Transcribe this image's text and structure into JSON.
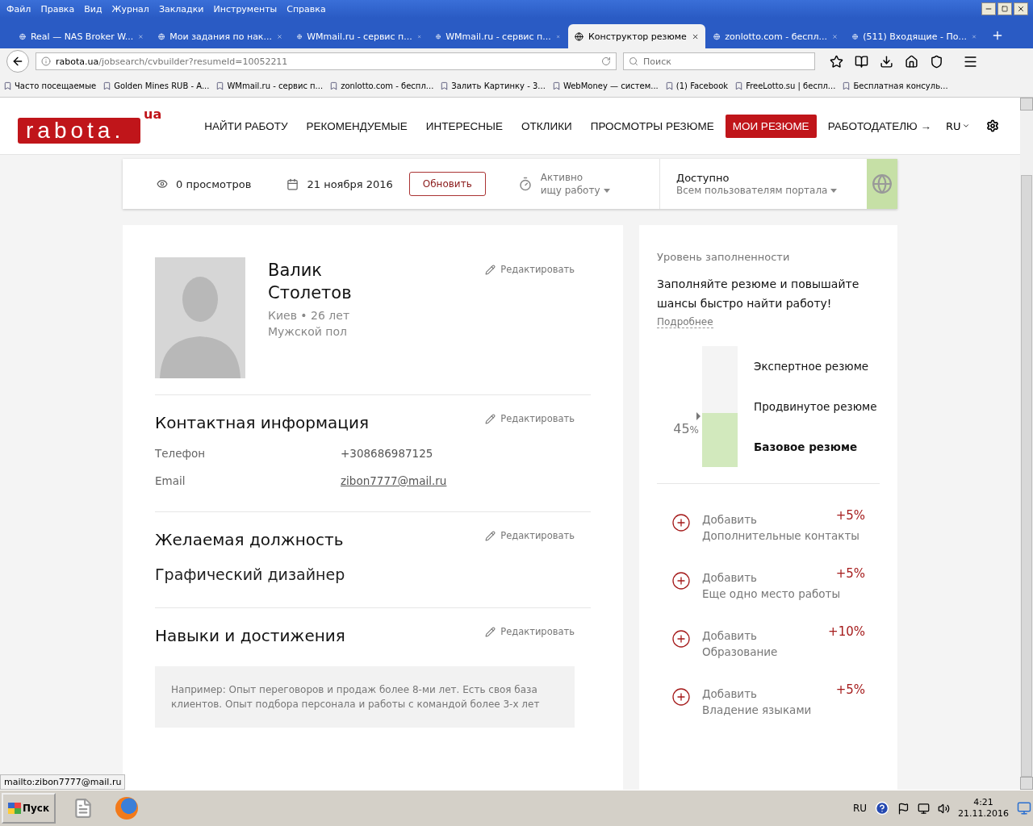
{
  "menu_bar": {
    "items": [
      "Файл",
      "Правка",
      "Вид",
      "Журнал",
      "Закладки",
      "Инструменты",
      "Справка"
    ]
  },
  "tabs": [
    {
      "title": "Real — NAS Broker W...",
      "selected": false
    },
    {
      "title": "Мои задания по нак...",
      "selected": false
    },
    {
      "title": "WMmail.ru - сервис п...",
      "selected": false
    },
    {
      "title": "WMmail.ru - сервис п...",
      "selected": false
    },
    {
      "title": "Конструктор резюме",
      "selected": true
    },
    {
      "title": "zonlotto.com - беспл...",
      "selected": false
    },
    {
      "title": "(511) Входящие - По...",
      "selected": false
    }
  ],
  "address_bar": {
    "url_host": "rabota.ua",
    "url_path": "/jobsearch/cvbuilder?resumeId=10052211"
  },
  "search": {
    "placeholder": "Поиск"
  },
  "bookmarks": [
    {
      "label": "Часто посещаемые"
    },
    {
      "label": "Golden Mines RUB - A..."
    },
    {
      "label": "WMmail.ru - сервис п..."
    },
    {
      "label": "zonlotto.com - беспл..."
    },
    {
      "label": "Залить Картинку - 3..."
    },
    {
      "label": "WebMoney — систем..."
    },
    {
      "label": "(1) Facebook"
    },
    {
      "label": "FreeLotto.su | беспл..."
    },
    {
      "label": "Бесплатная консуль..."
    }
  ],
  "site_header": {
    "logo": "rabota.",
    "logo_suffix": "ua",
    "language": "RU",
    "nav": [
      {
        "label": "НАЙТИ РАБОТУ",
        "selected": false
      },
      {
        "label": "РЕКОМЕНДУЕМЫЕ",
        "selected": false
      },
      {
        "label": "ИНТЕРЕСНЫЕ",
        "selected": false
      },
      {
        "label": "ОТКЛИКИ",
        "selected": false
      },
      {
        "label": "ПРОСМОТРЫ РЕЗЮМЕ",
        "selected": false
      },
      {
        "label": "МОИ РЕЗЮМЕ",
        "selected": true
      },
      {
        "label": "РАБОТОДАТЕЛЮ →",
        "selected": false
      }
    ]
  },
  "stats_bar": {
    "views": "0 просмотров",
    "date": "21 ноября 2016",
    "refresh_button": "Обновить",
    "status_line1": "Активно",
    "status_line2": "ищу работу",
    "visibility_title": "Доступно",
    "visibility_value": "Всем пользователям портала"
  },
  "profile": {
    "first_name": "Валик",
    "last_name": "Столетов",
    "location": "Киев • 26 лет",
    "gender": "Мужской пол",
    "edit": "Редактировать"
  },
  "sections": [
    {
      "kind": "contacts",
      "title": "Контактная информация",
      "edit": "Редактировать",
      "fields": [
        {
          "label": "Телефон",
          "value": "+308686987125",
          "link": false
        },
        {
          "label": "Email",
          "value": "zibon7777@mail.ru",
          "link": true
        }
      ]
    },
    {
      "kind": "text",
      "title": "Желаемая должность",
      "edit": "Редактировать",
      "value": "Графический дизайнер"
    },
    {
      "kind": "hint",
      "title": "Навыки и достижения",
      "edit": "Редактировать",
      "hint": "Например: Опыт переговоров и продаж более 8-ми лет. Есть своя база клиентов. Опыт подбора персонала и работы с командой более 3-х лет"
    }
  ],
  "completeness": {
    "title": "Уровень заполненности",
    "headline": "Заполняйте резюме и повышайте шансы быстро найти работу!",
    "more_link": "Подробнее",
    "percent": "45",
    "percent_sign": "%",
    "level": 0.45,
    "tiers": [
      {
        "label": "Экспертное резюме",
        "selected": false
      },
      {
        "label": "Продвинутое резюме",
        "selected": false
      },
      {
        "label": "Базовое резюме",
        "selected": true
      }
    ],
    "suggestions": [
      {
        "action": "Добавить",
        "detail": "Дополнительные контакты",
        "bonus": "+5%"
      },
      {
        "action": "Добавить",
        "detail": "Еще одно место работы",
        "bonus": "+5%"
      },
      {
        "action": "Добавить",
        "detail": "Образование",
        "bonus": "+10%"
      },
      {
        "action": "Добавить",
        "detail": "Владение языками",
        "bonus": "+5%"
      }
    ]
  },
  "status_tooltip": "mailto:zibon7777@mail.ru",
  "taskbar": {
    "start": "Пуск",
    "language": "RU",
    "time": "4:21",
    "date": "21.11.2016"
  }
}
